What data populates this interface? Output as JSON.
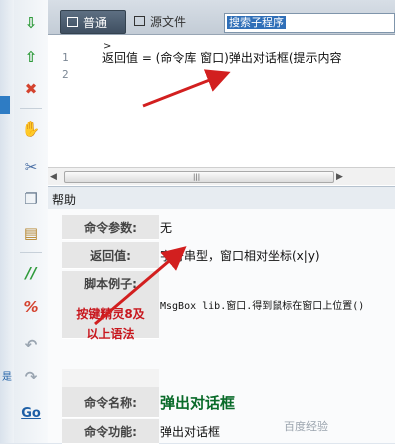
{
  "toolbar": {
    "icons": [
      "move-down-icon",
      "move-up-icon",
      "delete-icon",
      "hand-icon",
      "cut-icon",
      "copy-icon",
      "paste-icon",
      "comment-icon",
      "uncomment-icon",
      "undo-icon",
      "redo-icon",
      "goto-icon"
    ],
    "goto_label": "Go"
  },
  "left_strip": {
    "fragment": "是"
  },
  "tabs": {
    "normal": "普通",
    "source": "源文件"
  },
  "search": {
    "value": "搜索子程序"
  },
  "editor": {
    "line_numbers": [
      "1",
      "2"
    ],
    "fold_marker": ">",
    "code_line": "返回值 = (命令库 窗口)弹出对话框(提示内容"
  },
  "scrollbar": {
    "left": "◀",
    "grip": "|||",
    "right": "▶"
  },
  "help": {
    "title": "帮助",
    "param_label": "命令参数:",
    "param_value": "无",
    "return_label": "返回值:",
    "return_value": "字符串型，窗口相对坐标(x|y)",
    "example_label": "脚本例子:",
    "example_note": "按键精灵8及以上语法",
    "example_code": "MsgBox lib.窗口.得到鼠标在窗口上位置()",
    "name_label": "命令名称:",
    "name_value": "弹出对话框",
    "func_label": "命令功能:",
    "func_value": "弹出对话框"
  },
  "watermark": "百度经验",
  "colors": {
    "accent_blue": "#2f6fb8",
    "annotation_red": "#d21f1f",
    "name_green": "#0a6b2a"
  }
}
